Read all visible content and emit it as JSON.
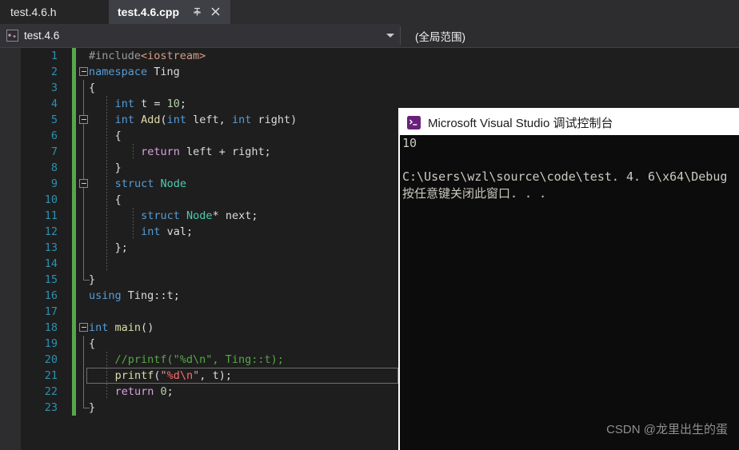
{
  "tabs": {
    "inactive": {
      "label": "test.4.6.h"
    },
    "active": {
      "label": "test.4.6.cpp",
      "pin_icon": "pin-icon",
      "close_icon": "close-icon"
    }
  },
  "navbar": {
    "project_icon": "cpp-project-icon",
    "project": "test.4.6",
    "dropdown_icon": "chevron-down-icon",
    "scope": "(全局范围)"
  },
  "editor": {
    "language": "cpp",
    "current_line": 21,
    "lines": [
      {
        "n": 1,
        "text": "#include<iostream>"
      },
      {
        "n": 2,
        "text": "namespace Ting"
      },
      {
        "n": 3,
        "text": "{"
      },
      {
        "n": 4,
        "text": "    int t = 10;"
      },
      {
        "n": 5,
        "text": "    int Add(int left, int right)"
      },
      {
        "n": 6,
        "text": "    {"
      },
      {
        "n": 7,
        "text": "        return left + right;"
      },
      {
        "n": 8,
        "text": "    }"
      },
      {
        "n": 9,
        "text": "    struct Node"
      },
      {
        "n": 10,
        "text": "    {"
      },
      {
        "n": 11,
        "text": "        struct Node* next;"
      },
      {
        "n": 12,
        "text": "        int val;"
      },
      {
        "n": 13,
        "text": "    };"
      },
      {
        "n": 14,
        "text": ""
      },
      {
        "n": 15,
        "text": "}"
      },
      {
        "n": 16,
        "text": "using Ting::t;"
      },
      {
        "n": 17,
        "text": ""
      },
      {
        "n": 18,
        "text": "int main()"
      },
      {
        "n": 19,
        "text": "{"
      },
      {
        "n": 20,
        "text": "    //printf(\"%d\\n\", Ting::t);"
      },
      {
        "n": 21,
        "text": "    printf(\"%d\\n\", t);"
      },
      {
        "n": 22,
        "text": "    return 0;"
      },
      {
        "n": 23,
        "text": "}"
      }
    ]
  },
  "console": {
    "icon": "console-app-icon",
    "title": "Microsoft Visual Studio 调试控制台",
    "output": [
      "10",
      "",
      "C:\\Users\\wzl\\source\\code\\test. 4. 6\\x64\\Debug",
      "按任意键关闭此窗口. . ."
    ]
  },
  "watermark": {
    "text": "CSDN @龙里出生的蛋"
  },
  "colors": {
    "editor_bg": "#1e1e1e",
    "chrome_bg": "#2d2d30",
    "active_tab_bg": "#3f3f46",
    "line_number": "#2b91af",
    "saved_marker": "#57a64a",
    "keyword": "#569cd6",
    "type": "#4ec9b0",
    "function": "#dcdcaa",
    "control": "#d8a0df",
    "string": "#d69d85",
    "escape": "#ff6b68",
    "number": "#b5cea8",
    "comment": "#57a64a",
    "console_bg": "#0c0c0c"
  }
}
